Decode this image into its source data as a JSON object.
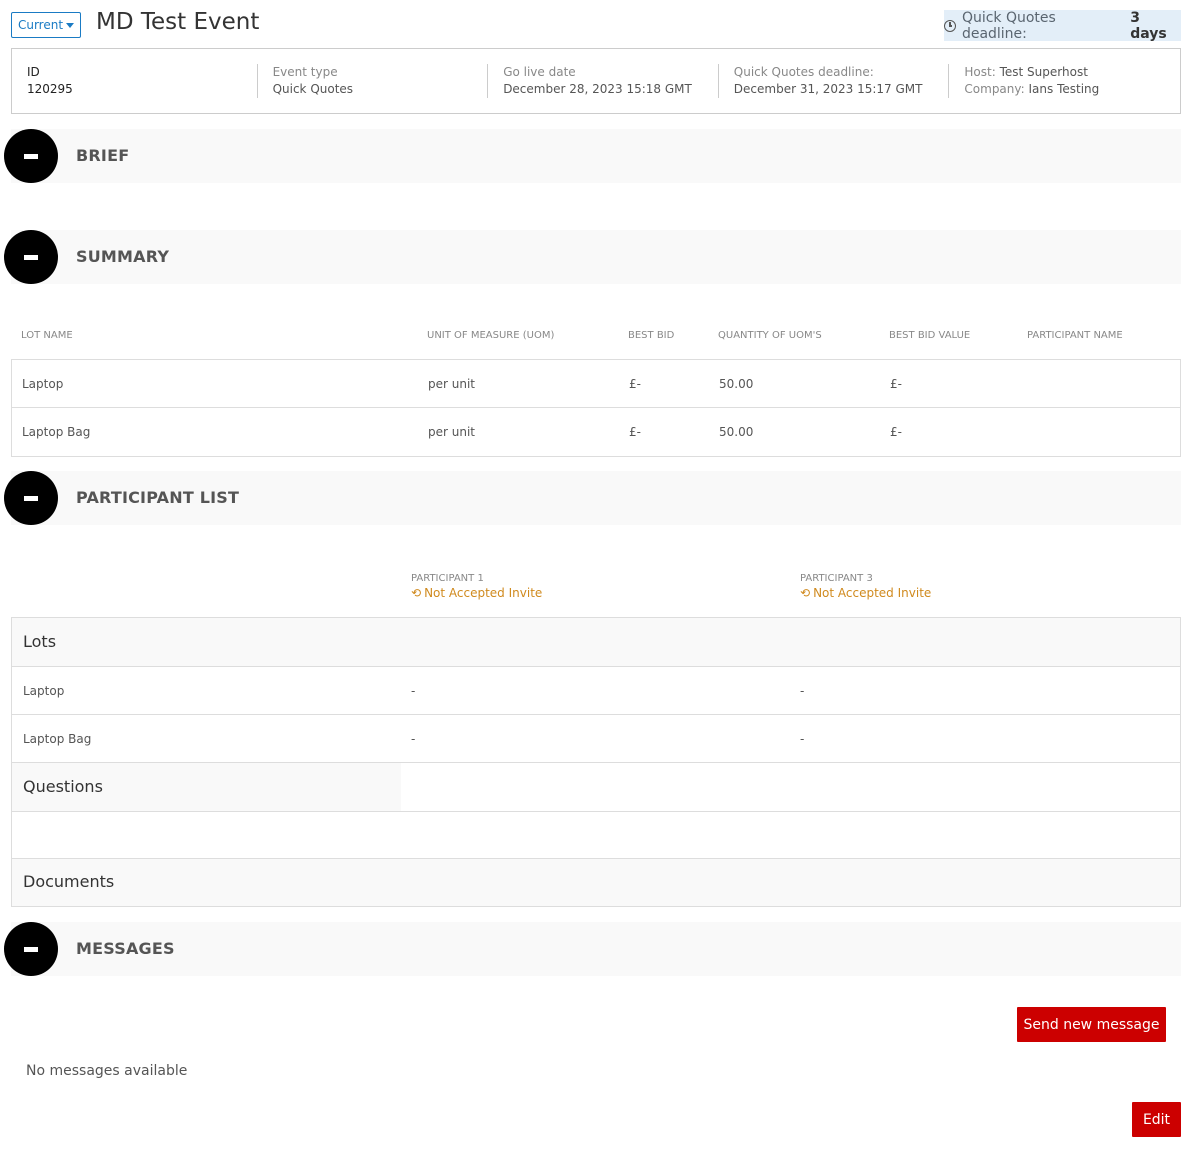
{
  "header": {
    "status_label": "Current",
    "title": "MD Test Event",
    "deadline_label": "Quick Quotes deadline:",
    "deadline_value": "3 days"
  },
  "info": {
    "id_label": "ID",
    "id_value": "120295",
    "type_label": "Event type",
    "type_value": "Quick Quotes",
    "golive_label": "Go live date",
    "golive_value": "December 28, 2023 15:18 GMT",
    "qqdeadline_label": "Quick Quotes deadline:",
    "qqdeadline_value": "December 31, 2023 15:17 GMT",
    "host_label": "Host:",
    "host_value": "Test Superhost",
    "company_label": "Company:",
    "company_value": "Ians Testing"
  },
  "sections": {
    "brief": "BRIEF",
    "summary": "SUMMARY",
    "participants": "PARTICIPANT LIST",
    "messages": "MESSAGES"
  },
  "summary": {
    "headers": [
      "LOT NAME",
      "UNIT OF MEASURE (UOM)",
      "BEST BID",
      "QUANTITY OF UOM'S",
      "BEST BID VALUE",
      "PARTICIPANT NAME"
    ],
    "rows": [
      [
        "Laptop",
        "per unit",
        "£-",
        "50.00",
        "£-",
        ""
      ],
      [
        "Laptop Bag",
        "per unit",
        "£-",
        "50.00",
        "£-",
        ""
      ]
    ]
  },
  "participant_list": {
    "participants": [
      {
        "name": "PARTICIPANT 1",
        "status": "Not Accepted Invite"
      },
      {
        "name": "PARTICIPANT 3",
        "status": "Not Accepted Invite"
      }
    ],
    "lots_title": "Lots",
    "lots": [
      {
        "name": "Laptop",
        "p1": "-",
        "p3": "-"
      },
      {
        "name": "Laptop Bag",
        "p1": "-",
        "p3": "-"
      }
    ],
    "questions_title": "Questions",
    "documents_title": "Documents"
  },
  "messages": {
    "send_label": "Send new message",
    "empty_text": "No messages available",
    "edit_label": "Edit"
  },
  "colors": {
    "accent": "#1a7bc4",
    "danger": "#cc0000",
    "warning": "#d08a1e"
  }
}
